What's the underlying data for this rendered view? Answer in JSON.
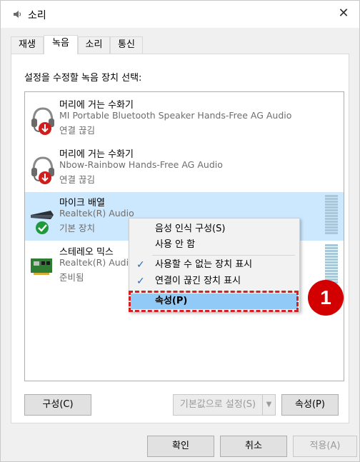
{
  "window": {
    "title": "소리",
    "close_glyph": "✕"
  },
  "tabs": [
    {
      "label": "재생"
    },
    {
      "label": "녹음"
    },
    {
      "label": "소리"
    },
    {
      "label": "통신"
    }
  ],
  "active_tab": "녹음",
  "instruction": "설정을 수정할 녹음 장치 선택:",
  "devices": [
    {
      "name": "머리에 거는 수화기",
      "desc": "MI Portable Bluetooth Speaker Hands-Free AG Audio",
      "status": "연결 끊김",
      "icon": "headset-disconnected-icon"
    },
    {
      "name": "머리에 거는 수화기",
      "desc": "Nbow-Rainbow Hands-Free AG Audio",
      "status": "연결 끊김",
      "icon": "headset-disconnected-icon"
    },
    {
      "name": "마이크 배열",
      "desc": "Realtek(R) Audio",
      "status": "기본 장치",
      "icon": "microphone-array-default-icon",
      "selected": true
    },
    {
      "name": "스테레오 믹스",
      "desc": "Realtek(R) Audio",
      "status": "준비됨",
      "icon": "sound-card-icon"
    }
  ],
  "context_menu": {
    "items": [
      {
        "label": "음성 인식 구성(S)",
        "checked": false
      },
      {
        "label": "사용 안 함",
        "checked": false
      },
      {
        "label": "사용할 수 없는 장치 표시",
        "checked": true
      },
      {
        "label": "연결이 끊긴 장치 표시",
        "checked": true
      },
      {
        "label": "속성(P)",
        "checked": false,
        "highlighted": true
      }
    ],
    "check_glyph": "✓"
  },
  "annotation": {
    "step_number": "1",
    "color": "#d20000"
  },
  "panel_buttons": {
    "configure": "구성(C)",
    "set_default": "기본값으로 설정(S)",
    "set_default_arrow": "▼",
    "properties": "속성(P)"
  },
  "dialog_buttons": {
    "ok": "확인",
    "cancel": "취소",
    "apply": "적용(A)"
  },
  "colors": {
    "selection": "#cce8ff",
    "menu_hot": "#91c9f7",
    "accent_red": "#d20000"
  }
}
